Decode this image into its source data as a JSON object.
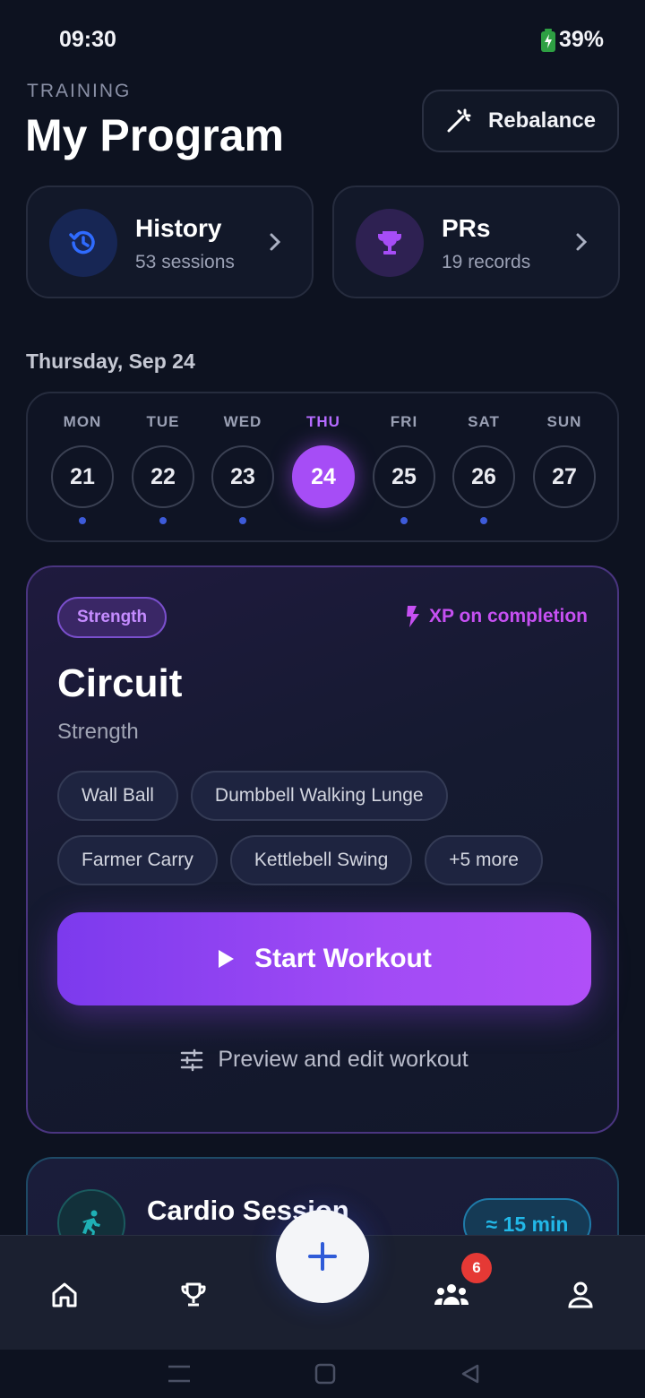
{
  "status": {
    "time": "09:30",
    "battery": "39%"
  },
  "header": {
    "eyebrow": "TRAINING",
    "title": "My Program",
    "rebalance_label": "Rebalance"
  },
  "quick_cards": [
    {
      "title": "History",
      "subtitle": "53 sessions",
      "icon": "history-icon",
      "accent": "#2f5bd8"
    },
    {
      "title": "PRs",
      "subtitle": "19 records",
      "icon": "trophy-icon",
      "accent": "#a64df6"
    }
  ],
  "date_label": "Thursday, Sep 24",
  "week": [
    {
      "name": "MON",
      "num": "21",
      "has_dot": true
    },
    {
      "name": "TUE",
      "num": "22",
      "has_dot": true
    },
    {
      "name": "WED",
      "num": "23",
      "has_dot": true
    },
    {
      "name": "THU",
      "num": "24",
      "has_dot": false,
      "selected": true
    },
    {
      "name": "FRI",
      "num": "25",
      "has_dot": true
    },
    {
      "name": "SAT",
      "num": "26",
      "has_dot": true
    },
    {
      "name": "SUN",
      "num": "27",
      "has_dot": false
    }
  ],
  "workout": {
    "tag": "Strength",
    "xp_label": "XP on completion",
    "title": "Circuit",
    "subtitle": "Strength",
    "exercises": [
      "Wall Ball",
      "Dumbbell Walking Lunge",
      "Farmer Carry",
      "Kettlebell Swing",
      "+5 more"
    ],
    "start_label": "Start Workout",
    "preview_label": "Preview and edit workout"
  },
  "cardio": {
    "title": "Cardio Session",
    "duration": "≈ 15 min"
  },
  "bottom_nav": {
    "notification_count": "6"
  },
  "colors": {
    "accent_purple": "#a64df6",
    "accent_blue": "#2f5bd8",
    "cyan": "#22b8e8",
    "badge_red": "#e53935"
  }
}
